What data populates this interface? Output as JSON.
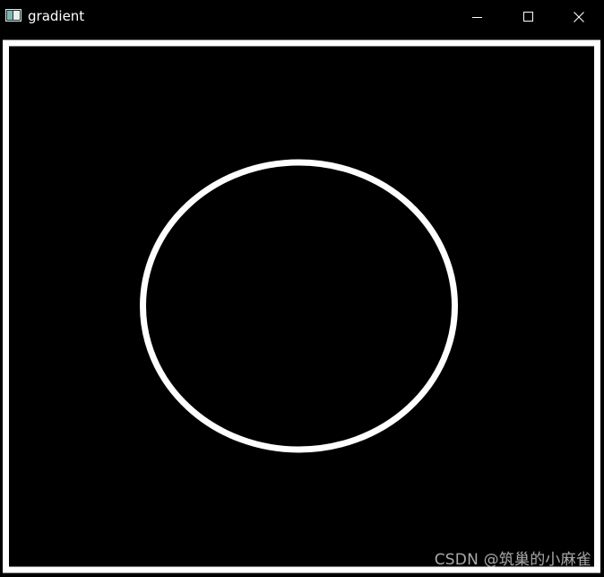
{
  "window": {
    "title": "gradient",
    "icon": "opencv-window-icon",
    "controls": {
      "minimize_icon": "minimize-icon",
      "maximize_icon": "maximize-icon",
      "close_icon": "close-icon"
    }
  },
  "image": {
    "background": "#000000",
    "stroke_color": "#ffffff"
  },
  "watermark": {
    "text": "CSDN @筑巢的小麻雀"
  }
}
